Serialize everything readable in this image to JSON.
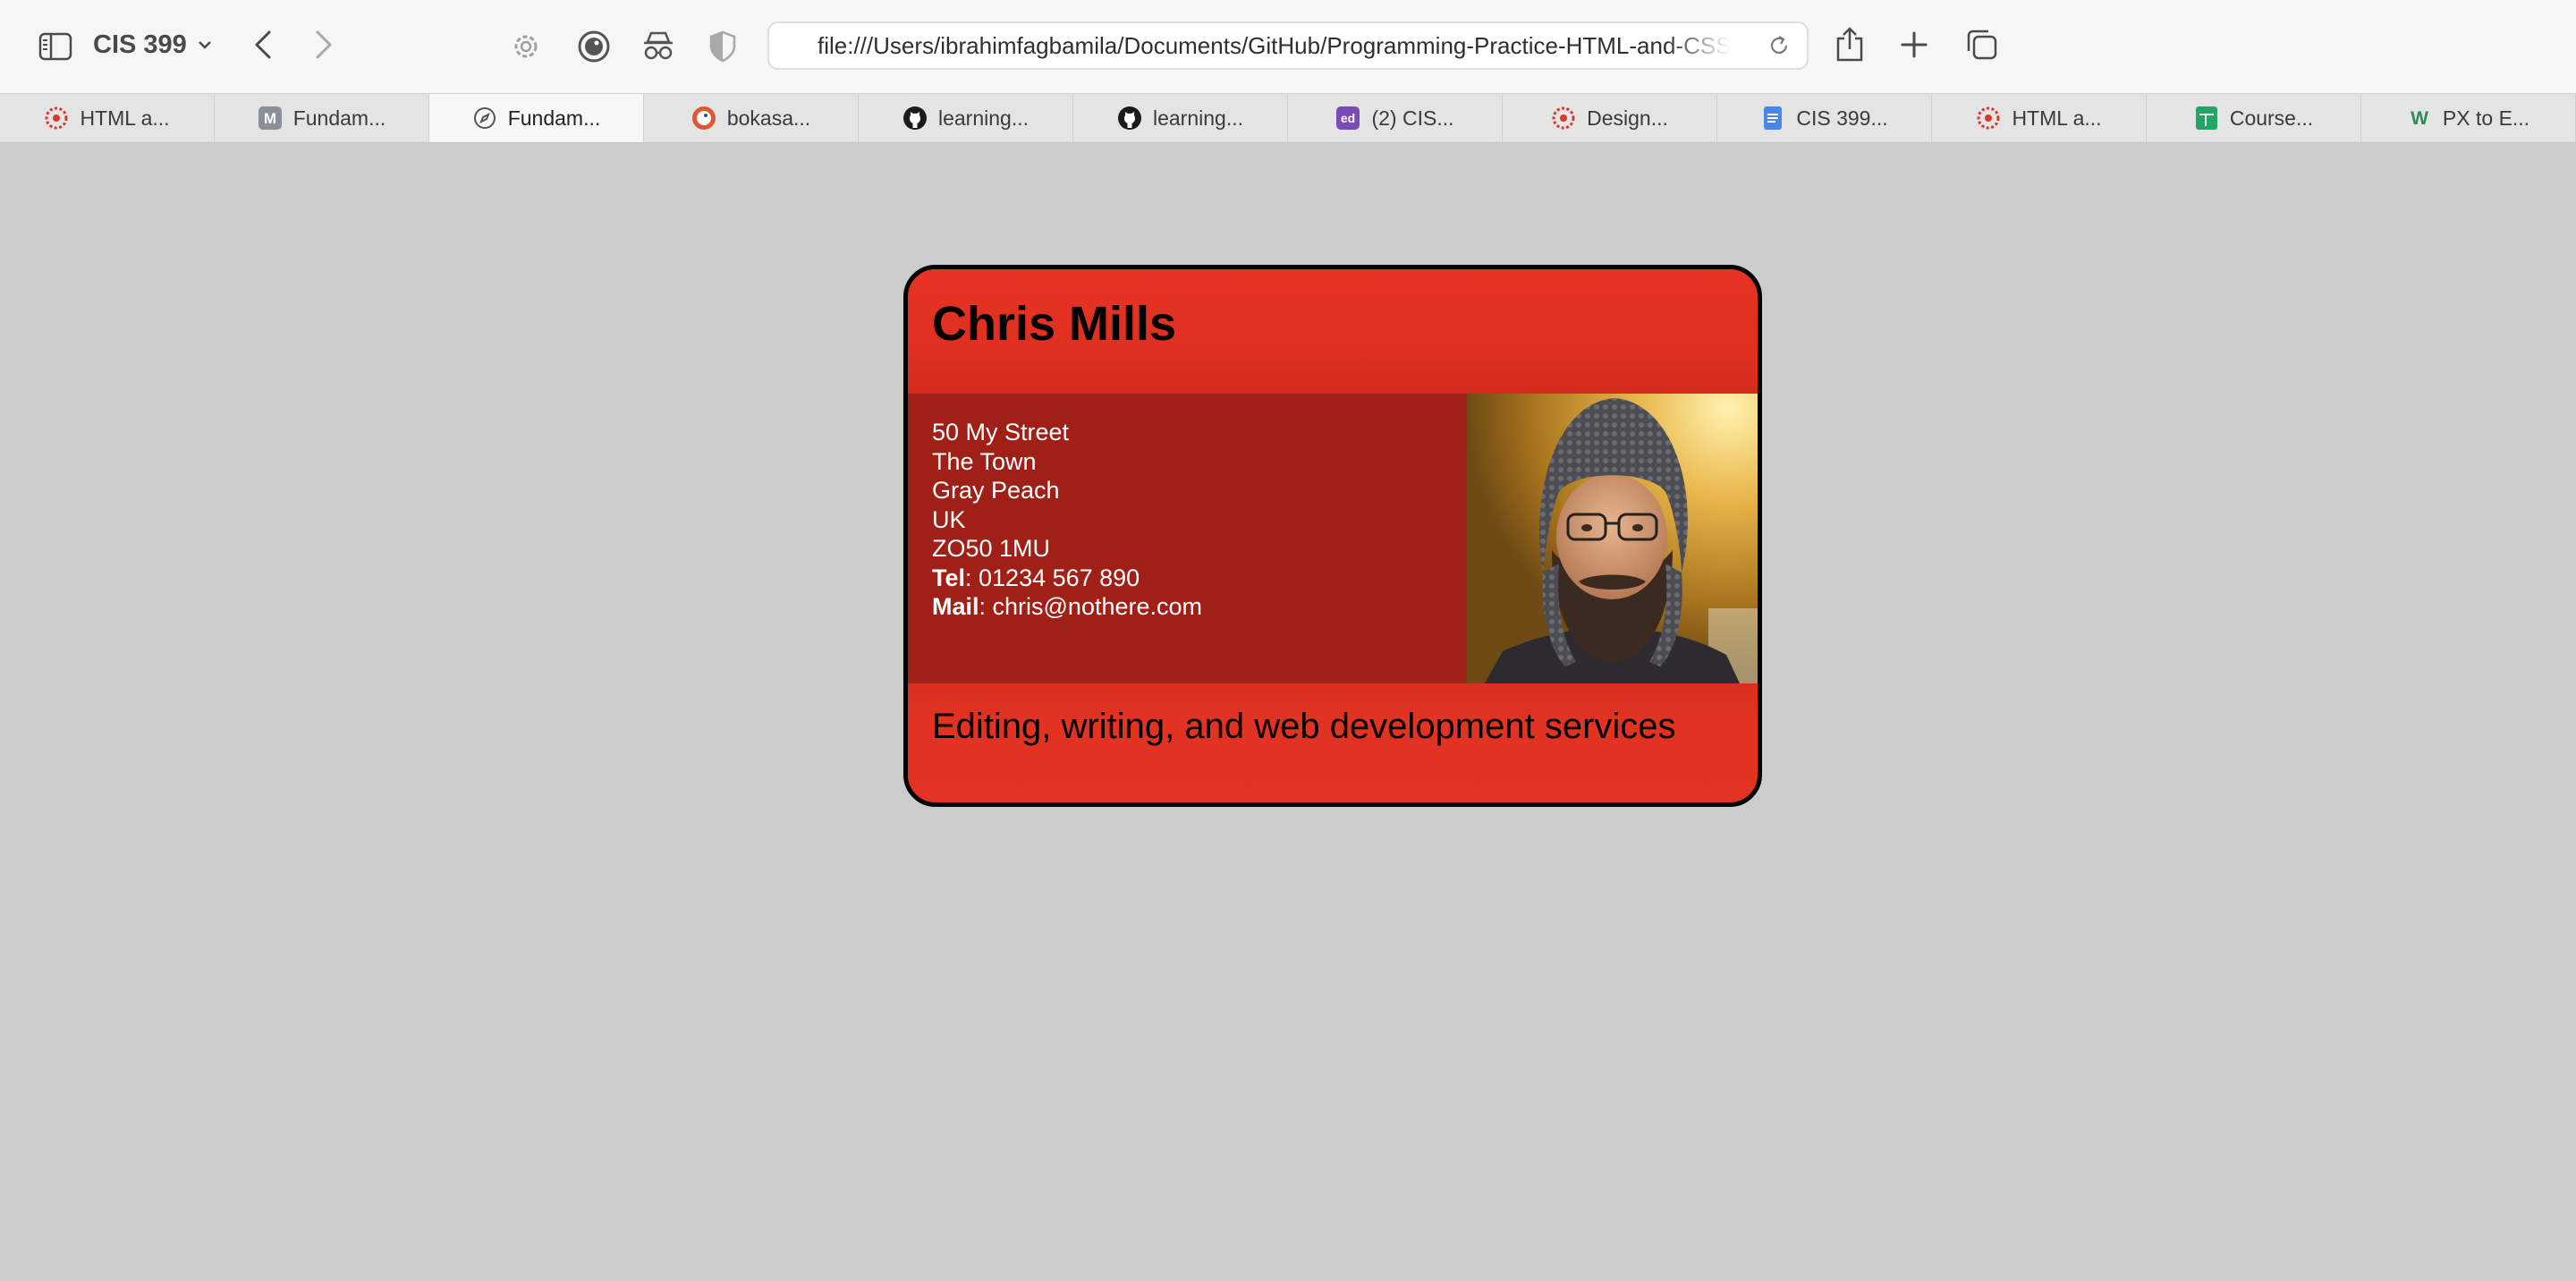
{
  "browser": {
    "tab_group": "CIS 399",
    "address": "file:///Users/ibrahimfagbamila/Documents/GitHub/Programming-Practice-HTML-and-CSS/fundamentals/business-card.html",
    "tabs": [
      {
        "label": "HTML a...",
        "icon": "canvas-icon",
        "active": false
      },
      {
        "label": "Fundam...",
        "icon": "m-letter-icon",
        "active": false
      },
      {
        "label": "Fundam...",
        "icon": "compass-icon",
        "active": true
      },
      {
        "label": "bokasa...",
        "icon": "duckduckgo-icon",
        "active": false
      },
      {
        "label": "learning...",
        "icon": "github-icon",
        "active": false
      },
      {
        "label": "learning...",
        "icon": "github-icon",
        "active": false
      },
      {
        "label": "(2) CIS...",
        "icon": "ed-icon",
        "active": false
      },
      {
        "label": "Design...",
        "icon": "canvas-icon",
        "active": false
      },
      {
        "label": "CIS 399...",
        "icon": "google-docs-icon",
        "active": false
      },
      {
        "label": "HTML a...",
        "icon": "canvas-icon",
        "active": false
      },
      {
        "label": "Course...",
        "icon": "google-sheets-icon",
        "active": false
      },
      {
        "label": "PX to E...",
        "icon": "w-letter-icon",
        "active": false
      }
    ]
  },
  "card": {
    "name": "Chris Mills",
    "address_lines": [
      "50 My Street",
      "The Town",
      "Gray Peach",
      "UK",
      "ZO50 1MU"
    ],
    "tel_label": "Tel",
    "tel_value": ": 01234 567 890",
    "mail_label": "Mail",
    "mail_value": ": chris@nothere.com",
    "tagline": "Editing, writing, and web development services"
  },
  "colors": {
    "page_background": "#cccccc",
    "card_red": "#e03222",
    "card_dark_red": "#a01f16",
    "card_border": "#000000"
  }
}
